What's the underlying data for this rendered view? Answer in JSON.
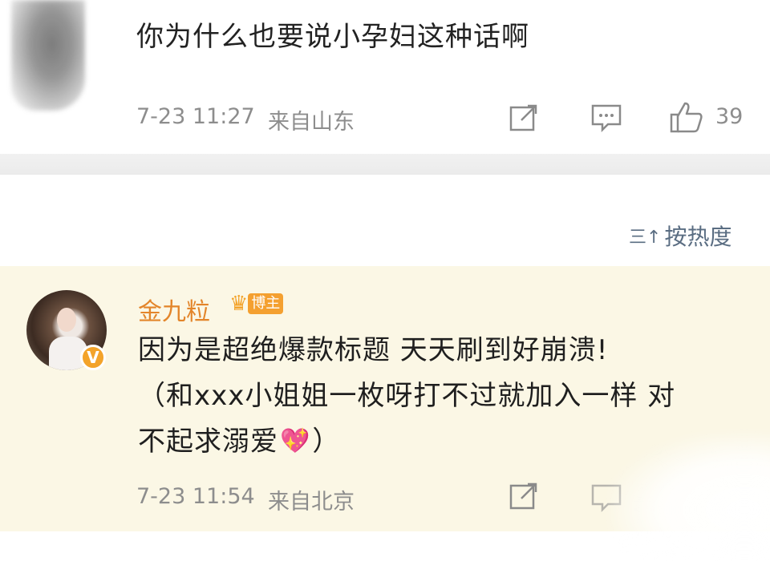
{
  "top_comment": {
    "text": "你为什么也要说小孕妇这种话啊",
    "time": "7-23 11:27",
    "location": "来自山东",
    "like_count": "39",
    "icons": {
      "share": "share-icon",
      "comment": "comment-icon",
      "like": "like-icon"
    }
  },
  "sort": {
    "label": "按热度",
    "icon": "sort-icon",
    "icon_glyph": "三↑"
  },
  "blogger_comment": {
    "username": "金九粒",
    "badge": "博主",
    "lines": [
      "因为是超绝爆款标题 天天刷到好崩溃!",
      "（和xxx小姐姐一枚呀打不过就加入一样 对",
      "不起求溺爱"
    ],
    "line3_suffix": "）",
    "time": "7-23 11:54",
    "location": "来自北京",
    "icons": {
      "avatar": "avatar",
      "verified": "verified-badge-icon",
      "crown": "crown-icon",
      "emoji": "heart-emoji-icon"
    }
  },
  "colors": {
    "username": "#e3852a",
    "badge_bg": "#f4a030",
    "highlight_bg": "#fbf7e5",
    "meta_gray": "#8d8d8d",
    "sort_blue": "#5a6d82"
  }
}
